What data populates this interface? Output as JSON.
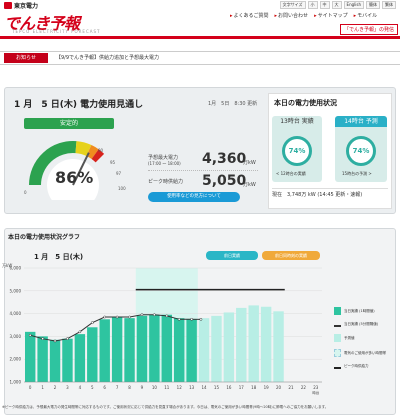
{
  "header": {
    "company": "東京電力",
    "brand": "でんき予報",
    "brand_sub": "TEPCO ELECTRICITY FORECAST",
    "util_links": [
      "文字サイズ",
      "小",
      "中",
      "大",
      "English",
      "簡体",
      "繁体"
    ],
    "nav": [
      "よくあるご質問",
      "お問い合わせ",
      "サイトマップ",
      "モバイル"
    ],
    "brand_link": "「でんき予報」の発信"
  },
  "notice": {
    "tag": "お知らせ",
    "text": "【9/9でんき予報】供給力追加と予想最大電力"
  },
  "forecast": {
    "title": "1 月　5 日(木) 電力使用見通し",
    "updated": "1月　5日　8:30 更新",
    "status": "安定的",
    "usage_rate": "86%",
    "gauge_value": 86,
    "gauge_ticks": [
      "0",
      "90",
      "95",
      "97",
      "100"
    ],
    "peak_label": "予想最大電力",
    "peak_time": "(17:00 ～ 18:00)",
    "peak_value": "4,360",
    "capacity_label": "ピーク時供給力",
    "capacity_value": "5,050",
    "unit": "万kW",
    "button": "使用率などの見方について"
  },
  "status_today": {
    "title": "本日の電力使用状況",
    "actual_head": "13時台 実績",
    "actual_rate": "74%",
    "actual_note": "< 12時台の実績",
    "forecast_head": "14時台 予測",
    "forecast_rate": "74%",
    "forecast_note": "15時台の予測 >",
    "current": "現在　3,748万 kW (14:45 更新・速報)"
  },
  "graph": {
    "title": "本日の電力使用状況グラフ",
    "date": "1 月　5 日(木)",
    "btn_today": "前日実績",
    "btn_yesterday": "前日同時刻の実績",
    "legend": [
      "当日実績 (1時間値)",
      "当日実績 (5分間隔値)",
      "予測値",
      "電気のご使用が多い時間帯",
      "ピーク時供給力"
    ],
    "footnote": "※ピーク時供給力は、予想最大電力の発生時間帯に対応するものです。ご使用状況に応じて供給力を見直す場合があります。今日は、電気のご使用が多い時間帯(9時～20時)に節電へのご協力をお願いします。",
    "colors": {
      "actual": "#2ec4a0",
      "forecast": "#b8eee5",
      "band": "#d7f5ef",
      "capacity": "#222222"
    }
  },
  "chart_data": {
    "type": "bar",
    "categories": [
      "0",
      "1",
      "2",
      "3",
      "4",
      "5",
      "6",
      "7",
      "8",
      "9",
      "10",
      "11",
      "12",
      "13",
      "14",
      "15",
      "16",
      "17",
      "18",
      "19",
      "20",
      "21",
      "22",
      "23"
    ],
    "ytick_labels": [
      "1,000",
      "2,000",
      "3,000",
      "4,000",
      "5,000",
      "6,000"
    ],
    "yunit": "万kW",
    "xunit": "時台",
    "ylim": [
      1000,
      6000
    ],
    "series": [
      {
        "name": "当日実績 (1時間値)",
        "values": [
          3200,
          3000,
          2850,
          2900,
          3100,
          3400,
          3750,
          3850,
          3800,
          3900,
          3950,
          3950,
          3800,
          3748,
          null,
          null,
          null,
          null,
          null,
          null,
          null,
          null,
          null,
          null
        ]
      },
      {
        "name": "予測値",
        "values": [
          null,
          null,
          null,
          null,
          null,
          null,
          null,
          null,
          null,
          null,
          null,
          null,
          null,
          null,
          3800,
          3900,
          4050,
          4250,
          4360,
          4300,
          4100,
          null,
          null,
          null
        ]
      },
      {
        "name": "当日実績 (5分間隔値)",
        "x": [
          0,
          1,
          2,
          3,
          4,
          5,
          6,
          7,
          8,
          9,
          10,
          11,
          12,
          13,
          13.75
        ],
        "values": [
          3050,
          2900,
          2800,
          2900,
          3200,
          3600,
          3850,
          3850,
          3850,
          3950,
          3950,
          3900,
          3750,
          3750,
          3748
        ]
      }
    ],
    "capacity": {
      "name": "ピーク時供給力",
      "from_hour": 9,
      "to_hour": 21,
      "value": 5050
    },
    "peak_band": {
      "name": "電気のご使用が多い時間帯",
      "from_hour": 9,
      "to_hour": 14
    },
    "grid": true,
    "legend": "right"
  }
}
